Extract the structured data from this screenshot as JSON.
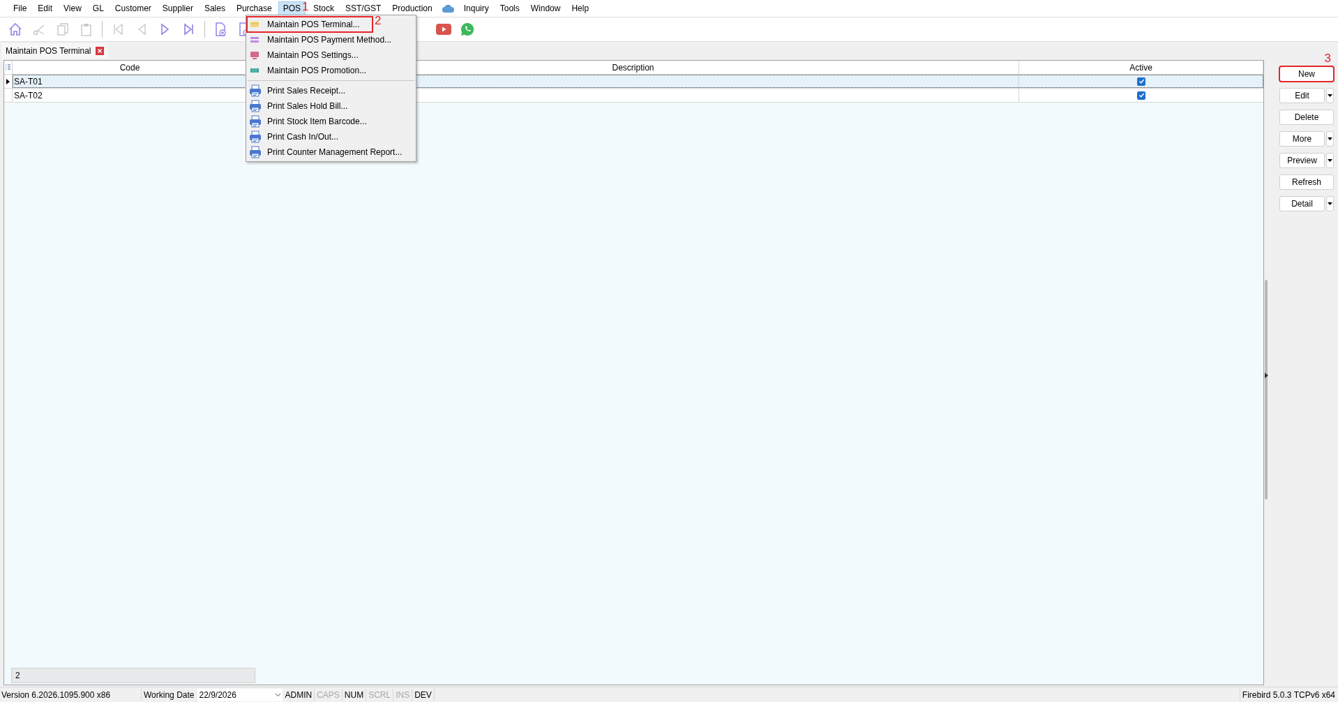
{
  "menubar": [
    {
      "kind": "menu",
      "label": "File",
      "selected": false
    },
    {
      "kind": "menu",
      "label": "Edit",
      "selected": false
    },
    {
      "kind": "menu",
      "label": "View",
      "selected": false
    },
    {
      "kind": "menu",
      "label": "GL",
      "selected": false
    },
    {
      "kind": "menu",
      "label": "Customer",
      "selected": false
    },
    {
      "kind": "menu",
      "label": "Supplier",
      "selected": false
    },
    {
      "kind": "menu",
      "label": "Sales",
      "selected": false
    },
    {
      "kind": "menu",
      "label": "Purchase",
      "selected": false
    },
    {
      "kind": "menu",
      "label": "POS",
      "selected": true,
      "annotation": "1"
    },
    {
      "kind": "menu",
      "label": "Stock",
      "selected": false
    },
    {
      "kind": "menu",
      "label": "SST/GST",
      "selected": false
    },
    {
      "kind": "menu",
      "label": "Production",
      "selected": false
    },
    {
      "kind": "cloud"
    },
    {
      "kind": "menu",
      "label": "Inquiry",
      "selected": false
    },
    {
      "kind": "menu",
      "label": "Tools",
      "selected": false
    },
    {
      "kind": "menu",
      "label": "Window",
      "selected": false
    },
    {
      "kind": "menu",
      "label": "Help",
      "selected": false
    }
  ],
  "pos_menu": [
    {
      "kind": "terminal",
      "label": "Maintain POS Terminal...",
      "annotation": "2"
    },
    {
      "kind": "payment",
      "label": "Maintain POS Payment Method..."
    },
    {
      "kind": "settings",
      "label": "Maintain POS Settings..."
    },
    {
      "kind": "promotion",
      "label": "Maintain POS Promotion..."
    },
    {
      "kind": "separator"
    },
    {
      "kind": "print",
      "label": "Print Sales Receipt..."
    },
    {
      "kind": "print",
      "label": "Print Sales Hold Bill..."
    },
    {
      "kind": "print",
      "label": "Print Stock Item Barcode..."
    },
    {
      "kind": "print",
      "label": "Print Cash In/Out..."
    },
    {
      "kind": "print",
      "label": "Print Counter Management Report..."
    }
  ],
  "document_tab": {
    "title": "Maintain POS Terminal"
  },
  "table": {
    "columns": [
      "Code",
      "Description",
      "Active"
    ],
    "rows": [
      {
        "code": "SA-T01",
        "description": "",
        "active": true,
        "selected": true
      },
      {
        "code": "SA-T02",
        "description": "",
        "active": true,
        "selected": false
      }
    ],
    "footer_count": "2"
  },
  "buttons": [
    {
      "label": "New",
      "dropdown": false,
      "annotation": "3"
    },
    {
      "label": "Edit",
      "dropdown": true
    },
    {
      "label": "Delete",
      "dropdown": false
    },
    {
      "label": "More",
      "dropdown": true
    },
    {
      "label": "Preview",
      "dropdown": true
    },
    {
      "label": "Refresh",
      "dropdown": false
    },
    {
      "label": "Detail",
      "dropdown": true
    }
  ],
  "status_bar": {
    "version": "Version 6.2026.1095.900 x86",
    "working_date_label": "Working Date",
    "working_date": "22/9/2026",
    "indicators": [
      {
        "label": "ADMIN",
        "on": true
      },
      {
        "label": "CAPS",
        "on": false
      },
      {
        "label": "NUM",
        "on": true
      },
      {
        "label": "SCRL",
        "on": false
      },
      {
        "label": "INS",
        "on": false
      },
      {
        "label": "DEV",
        "on": true
      }
    ],
    "database": "Firebird 5.0.3 TCPv6 x64"
  }
}
